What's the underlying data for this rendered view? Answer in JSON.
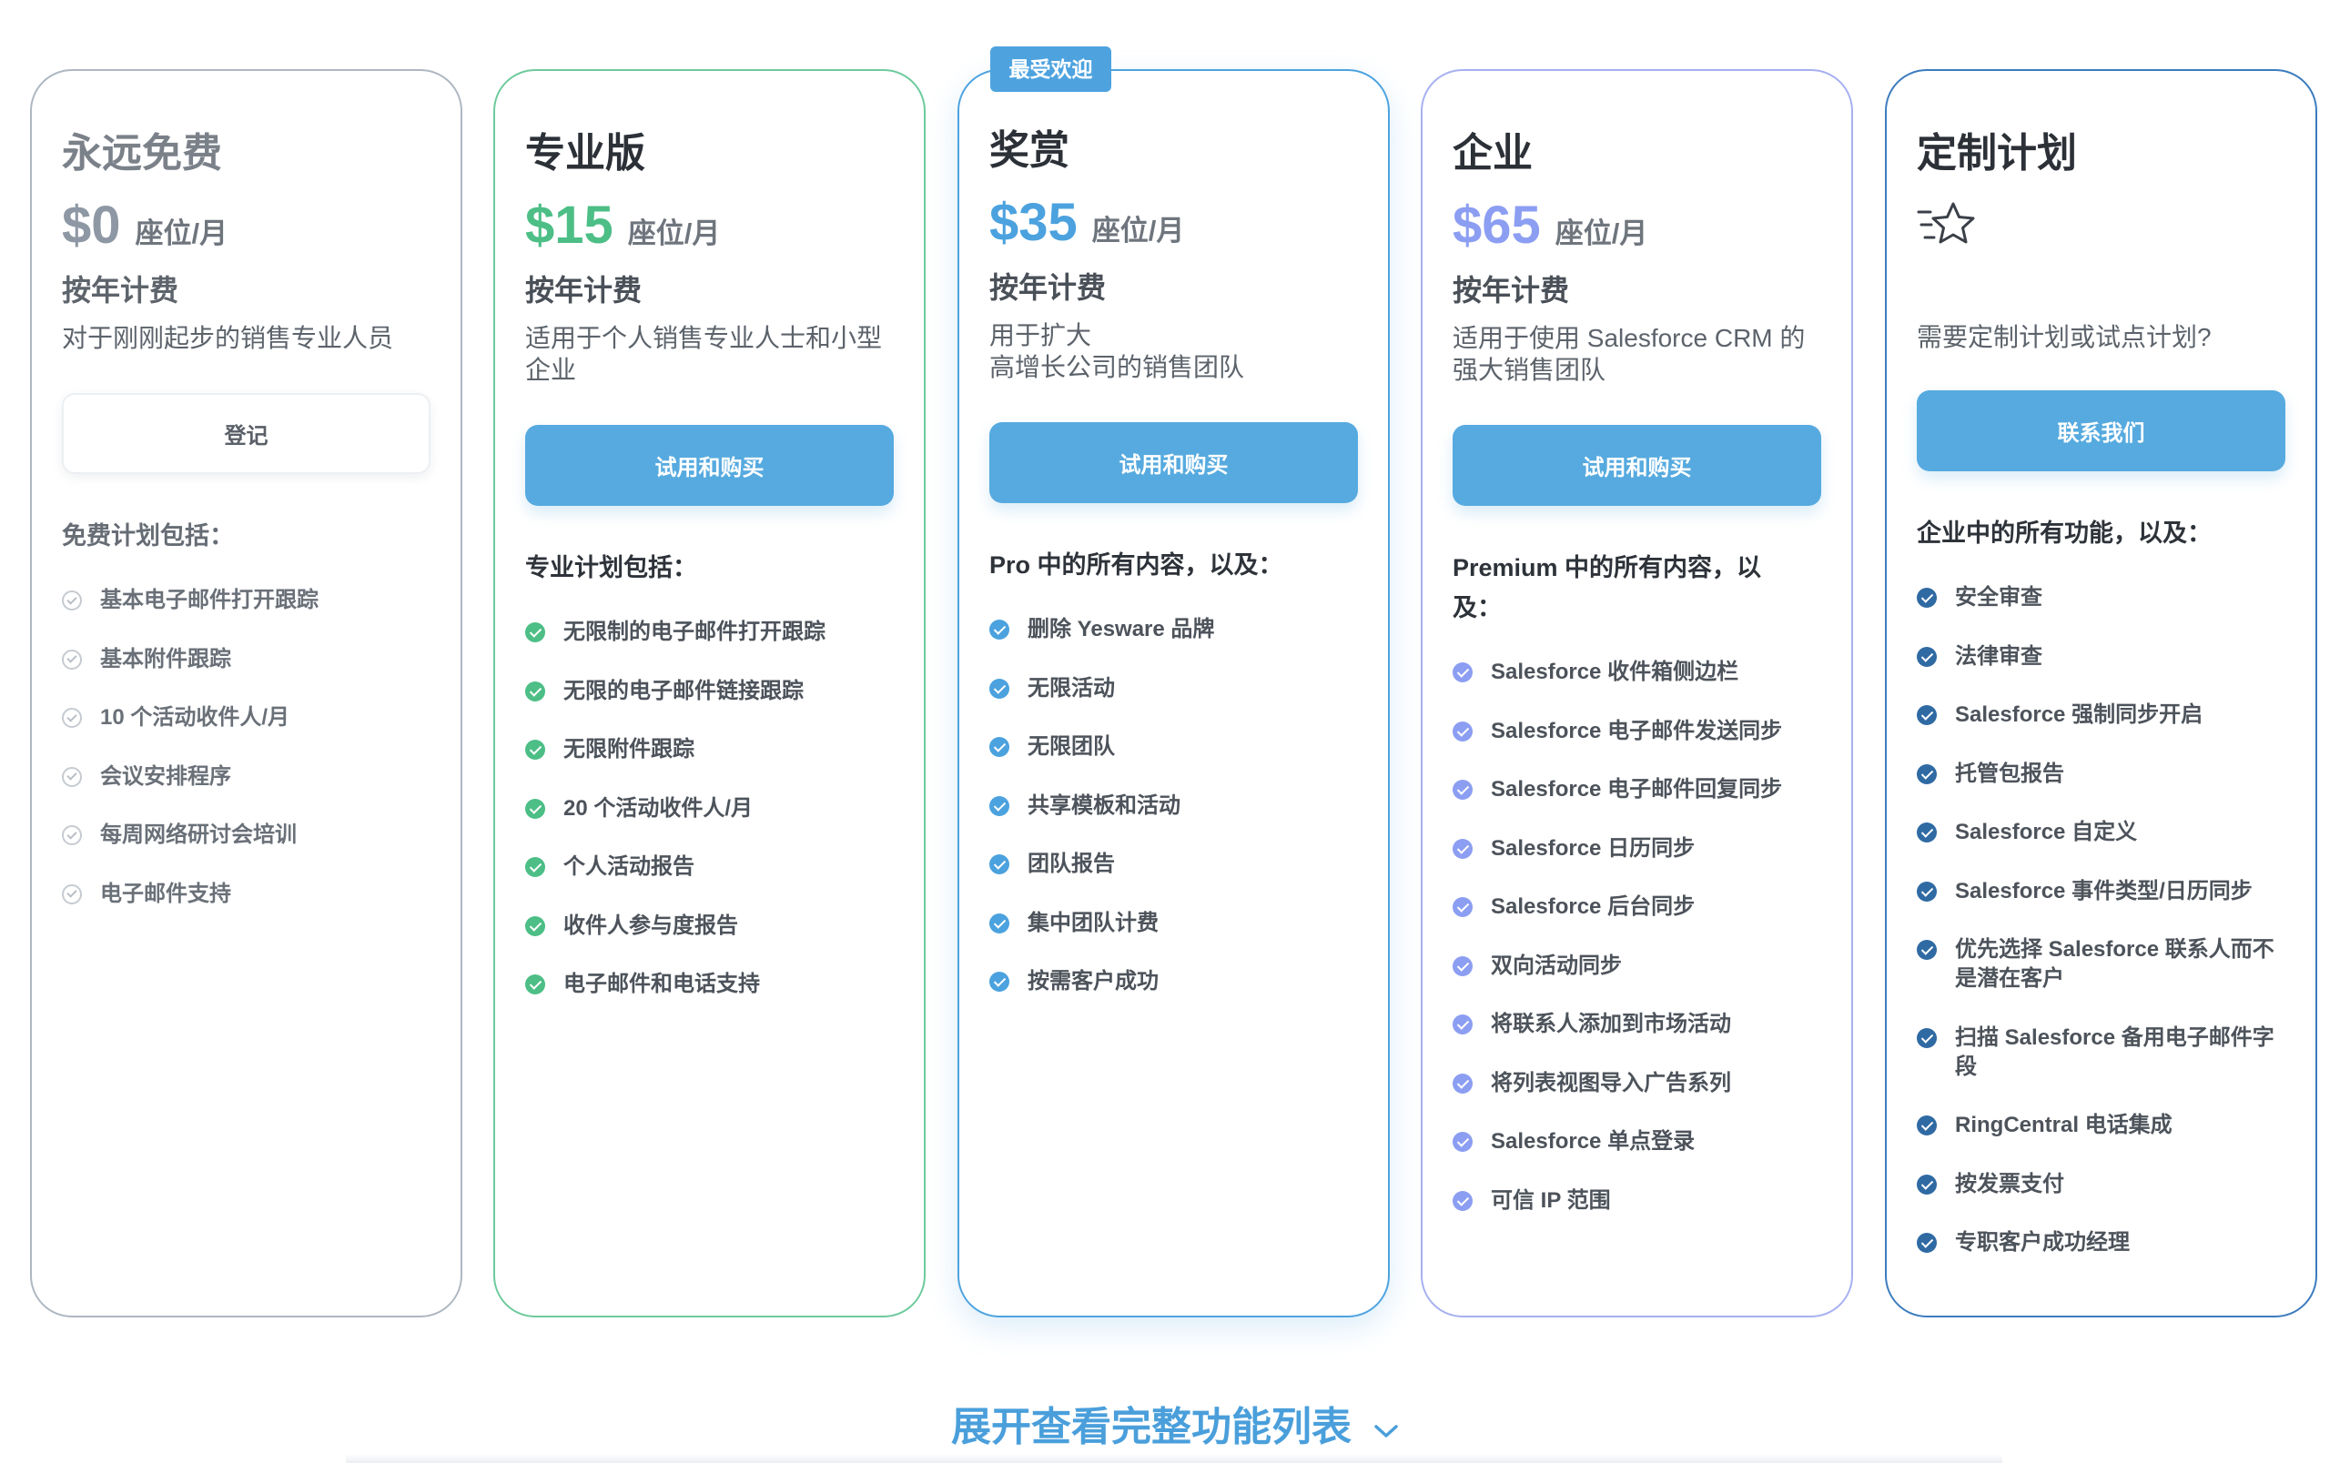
{
  "popular_badge": "最受欢迎",
  "theme": {
    "button": "#56aadf",
    "badge": "#4ea3df",
    "link": "#4a9fdb"
  },
  "icons": {
    "feature_check": "check-circle-icon",
    "custom_plan": "star-icon",
    "expand": "chevron-down-icon"
  },
  "plans": [
    {
      "title": "永远免费",
      "price": "$0",
      "unit": "座位/月",
      "billing": "按年计费",
      "description": [
        "对于刚刚起步的销售专业人员"
      ],
      "button": "登记",
      "features_header": "免费计划包括：",
      "features": [
        "基本电子邮件打开跟踪",
        "基本附件跟踪",
        "10 个活动收件人/月",
        "会议安排程序",
        "每周网络研讨会培训",
        "电子邮件支持"
      ],
      "accent": "#8e98a4",
      "border": "#aeb7c2"
    },
    {
      "title": "专业版",
      "price": "$15",
      "unit": "座位/月",
      "billing": "按年计费",
      "description": [
        "适用于个人销售专业人士和小型企业"
      ],
      "button": "试用和购买",
      "features_header": "专业计划包括：",
      "features": [
        "无限制的电子邮件打开跟踪",
        "无限的电子邮件链接跟踪",
        "无限附件跟踪",
        "20 个活动收件人/月",
        "个人活动报告",
        "收件人参与度报告",
        "电子邮件和电话支持"
      ],
      "accent": "#4cbe86",
      "border": "#6dca9c"
    },
    {
      "title": "奖赏",
      "price": "$35",
      "unit": "座位/月",
      "billing": "按年计费",
      "description": [
        "用于扩大",
        "高增长公司的销售团队"
      ],
      "button": "试用和购买",
      "features_header": "Pro 中的所有内容，以及：",
      "features": [
        "删除 Yesware 品牌",
        "无限活动",
        "无限团队",
        "共享模板和活动",
        "团队报告",
        "集中团队计费",
        "按需客户成功"
      ],
      "accent": "#4ba2de",
      "border": "#4ea3df"
    },
    {
      "title": "企业",
      "price": "$65",
      "unit": "座位/月",
      "billing": "按年计费",
      "description": [
        "适用于使用 Salesforce CRM 的强大销售团队"
      ],
      "button": "试用和购买",
      "features_header": "Premium 中的所有内容，以及：",
      "features": [
        "Salesforce 收件箱侧边栏",
        "Salesforce 电子邮件发送同步",
        "Salesforce 电子邮件回复同步",
        "Salesforce 日历同步",
        "Salesforce 后台同步",
        "双向活动同步",
        "将联系人添加到市场活动",
        "将列表视图导入广告系列",
        "Salesforce 单点登录",
        "可信 IP 范围"
      ],
      "accent": "#8c9ef2",
      "border": "#a6b0f0"
    },
    {
      "title": "定制计划",
      "icon": "star-icon",
      "description": [
        "需要定制计划或试点计划?"
      ],
      "button": "联系我们",
      "features_header": "企业中的所有功能，以及：",
      "features": [
        "安全审查",
        "法律审查",
        "Salesforce 强制同步开启",
        "托管包报告",
        "Salesforce 自定义",
        "Salesforce 事件类型/日历同步",
        "优先选择 Salesforce 联系人而不是潜在客户",
        "扫描 Salesforce 备用电子邮件字段",
        "RingCentral 电话集成",
        "按发票支付",
        "专职客户成功经理"
      ],
      "accent": "#2f6aa3",
      "border": "#3b7cbe"
    }
  ],
  "expand_link": {
    "label": "展开查看完整功能列表"
  }
}
